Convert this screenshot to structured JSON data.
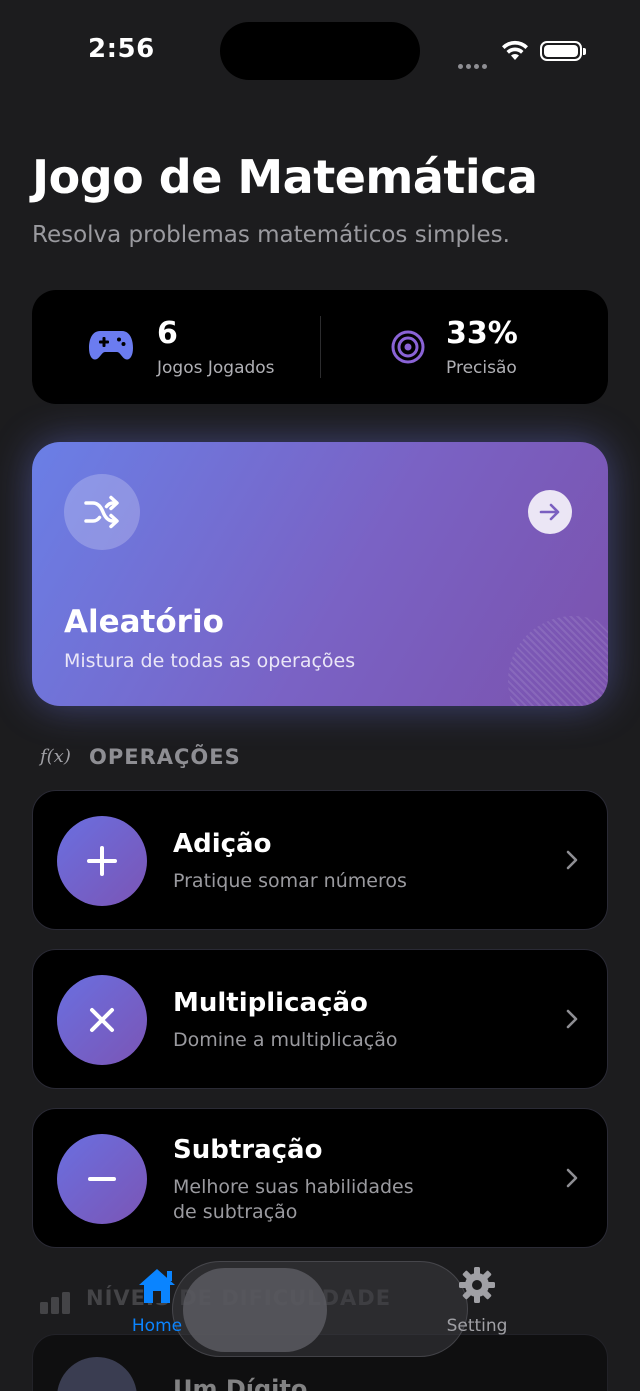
{
  "status_bar": {
    "time": "2:56"
  },
  "header": {
    "title": "Jogo de Matemática",
    "subtitle": "Resolva problemas matemáticos simples."
  },
  "stats": {
    "games_played": {
      "value": "6",
      "label": "Jogos Jogados",
      "icon": "gamepad-icon",
      "color": "#6b7cf0"
    },
    "accuracy": {
      "value": "33%",
      "label": "Precisão",
      "icon": "target-icon",
      "color": "#8a63d6"
    }
  },
  "random_mode": {
    "title": "Aleatório",
    "subtitle": "Mistura de todas as operações",
    "icon": "shuffle-icon",
    "gradient_start": "#6a7fe6",
    "gradient_end": "#7b52ad"
  },
  "operations_section": {
    "title": "OPERAÇÕES",
    "icon_text": "f(x)"
  },
  "operations": [
    {
      "title": "Adição",
      "description": "Pratique somar números",
      "icon": "plus-icon"
    },
    {
      "title": "Multiplicação",
      "description": "Domine a multiplicação",
      "icon": "times-icon"
    },
    {
      "title": "Subtração",
      "description_line1": "Melhore suas habilidades",
      "description_line2": "de subtração",
      "icon": "minus-icon"
    }
  ],
  "levels_section": {
    "title": "NÍVEIS DE DIFICULDADE",
    "first_item": "Um Dígito"
  },
  "tabbar": {
    "home": "Home",
    "setting": "Setting",
    "active_color": "#0a84ff"
  }
}
